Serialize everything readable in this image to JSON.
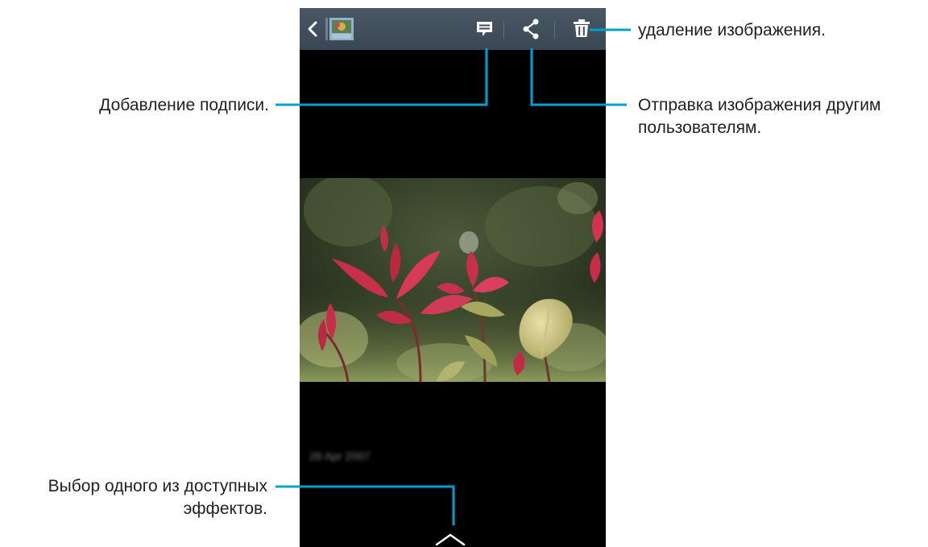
{
  "callouts": {
    "delete": "удаление изображения.",
    "caption": "Добавление подписи.",
    "share_line1": "Отправка изображения другим",
    "share_line2": "пользователям.",
    "effects_line1": "Выбор одного из доступных",
    "effects_line2": "эффектов."
  },
  "photo": {
    "date": "26 Apr 2007"
  },
  "colors": {
    "callout_line": "#00a0d2",
    "action_bar": "#3f4c59",
    "screen_bg": "#000000"
  },
  "icons": {
    "back": "chevron-left-icon",
    "thumbnail": "gallery-thumbnail-icon",
    "caption": "comment-icon",
    "share": "share-icon",
    "delete": "trash-icon",
    "expand": "chevron-up-icon"
  }
}
